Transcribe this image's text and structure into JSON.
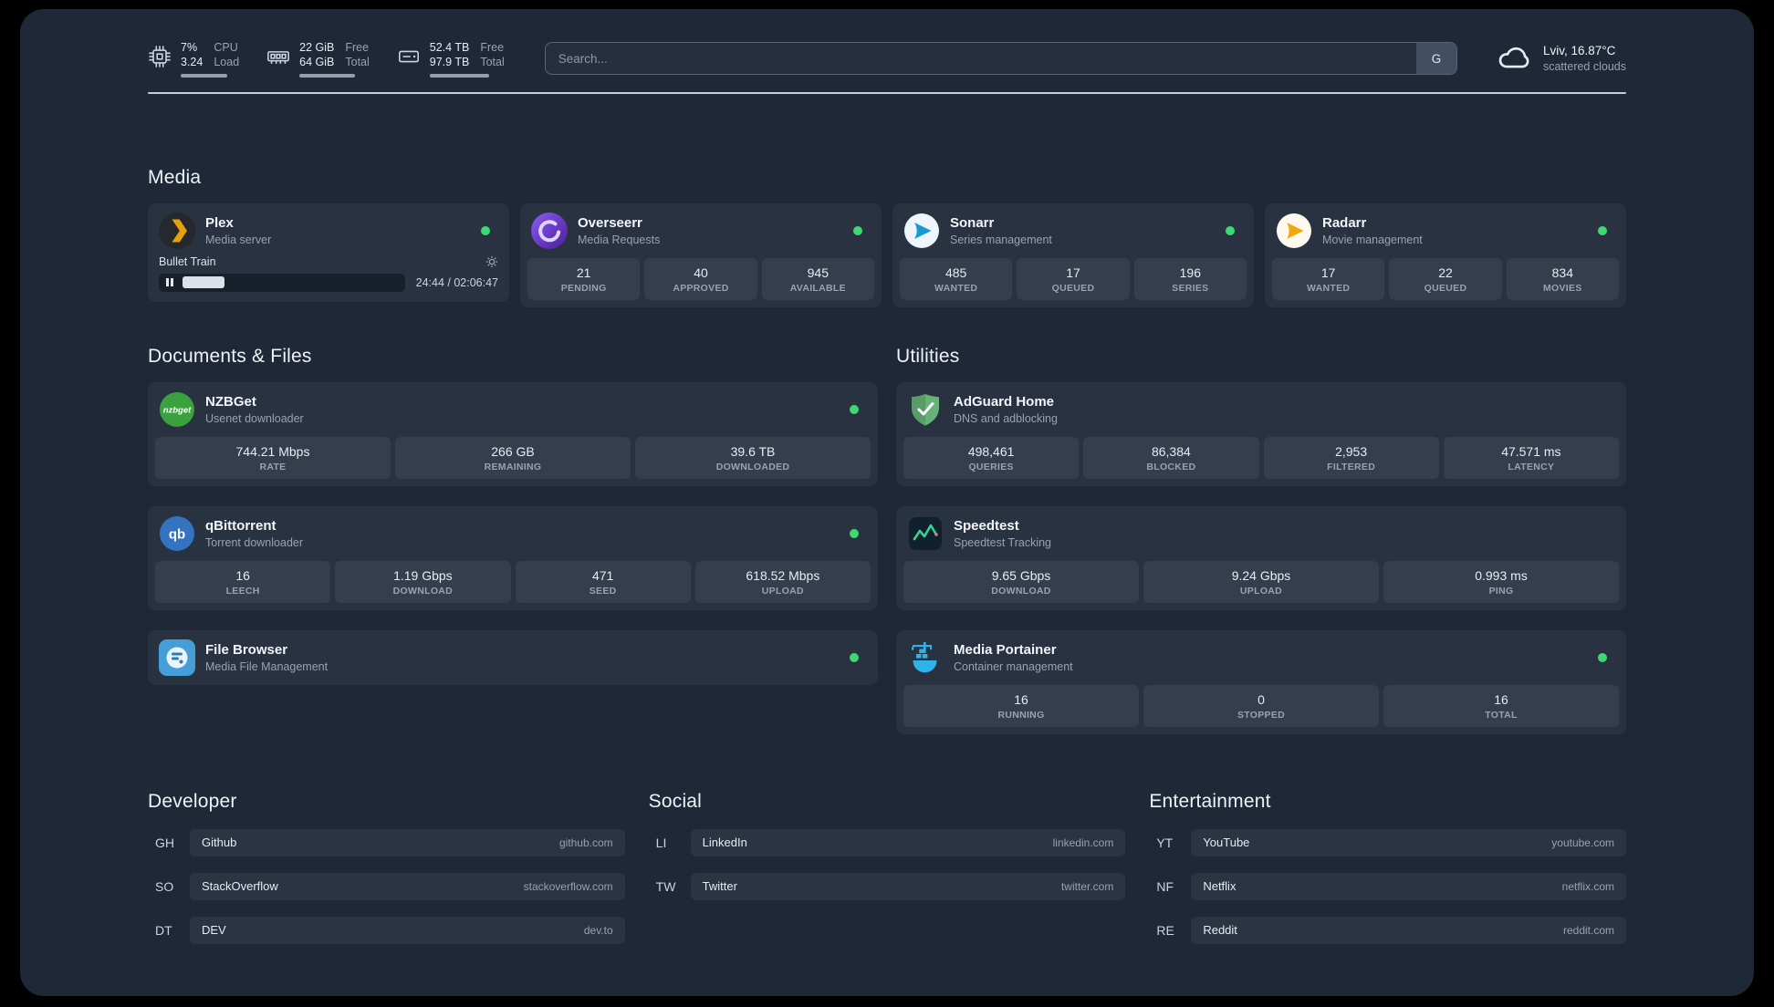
{
  "colors": {
    "background": "#1e2837",
    "status_online": "#3fd971",
    "plex_accent": "#e5a00d",
    "speedtest_line": "#34d399"
  },
  "topbar": {
    "cpu": {
      "percent": "7%",
      "load": "3.24",
      "label_top": "CPU",
      "label_bottom": "Load"
    },
    "memory": {
      "free": "22 GiB",
      "total": "64 GiB",
      "label_top": "Free",
      "label_bottom": "Total"
    },
    "disk": {
      "free": "52.4 TB",
      "total": "97.9 TB",
      "label_top": "Free",
      "label_bottom": "Total"
    },
    "search": {
      "placeholder": "Search...",
      "provider_button": "G"
    },
    "weather": {
      "location": "Lviv, 16.87°C",
      "condition": "scattered clouds"
    }
  },
  "sections": {
    "media": {
      "title": "Media",
      "services": [
        {
          "name": "Plex",
          "subtitle": "Media server",
          "icon": "plex-icon",
          "status": "online",
          "player": {
            "track": "Bullet Train",
            "time": "24:44 / 02:06:47"
          }
        },
        {
          "name": "Overseerr",
          "subtitle": "Media Requests",
          "icon": "overseerr-icon",
          "status": "online",
          "stats": [
            {
              "value": "21",
              "label": "PENDING"
            },
            {
              "value": "40",
              "label": "APPROVED"
            },
            {
              "value": "945",
              "label": "AVAILABLE"
            }
          ]
        },
        {
          "name": "Sonarr",
          "subtitle": "Series management",
          "icon": "sonarr-icon",
          "status": "online",
          "stats": [
            {
              "value": "485",
              "label": "WANTED"
            },
            {
              "value": "17",
              "label": "QUEUED"
            },
            {
              "value": "196",
              "label": "SERIES"
            }
          ]
        },
        {
          "name": "Radarr",
          "subtitle": "Movie management",
          "icon": "radarr-icon",
          "status": "online",
          "stats": [
            {
              "value": "17",
              "label": "WANTED"
            },
            {
              "value": "22",
              "label": "QUEUED"
            },
            {
              "value": "834",
              "label": "MOVIES"
            }
          ]
        }
      ]
    },
    "documents": {
      "title": "Documents & Files",
      "services": [
        {
          "name": "NZBGet",
          "subtitle": "Usenet downloader",
          "icon": "nzbget-icon",
          "icon_text": "nzbget",
          "status": "online",
          "stats": [
            {
              "value": "744.21 Mbps",
              "label": "RATE"
            },
            {
              "value": "266 GB",
              "label": "REMAINING"
            },
            {
              "value": "39.6 TB",
              "label": "DOWNLOADED"
            }
          ]
        },
        {
          "name": "qBittorrent",
          "subtitle": "Torrent downloader",
          "icon": "qbittorrent-icon",
          "icon_text": "qb",
          "status": "online",
          "stats": [
            {
              "value": "16",
              "label": "LEECH"
            },
            {
              "value": "1.19 Gbps",
              "label": "DOWNLOAD"
            },
            {
              "value": "471",
              "label": "SEED"
            },
            {
              "value": "618.52 Mbps",
              "label": "UPLOAD"
            }
          ]
        },
        {
          "name": "File Browser",
          "subtitle": "Media File Management",
          "icon": "filebrowser-icon",
          "status": "online",
          "stats": []
        }
      ]
    },
    "utilities": {
      "title": "Utilities",
      "services": [
        {
          "name": "AdGuard Home",
          "subtitle": "DNS and adblocking",
          "icon": "adguard-icon",
          "stats": [
            {
              "value": "498,461",
              "label": "QUERIES"
            },
            {
              "value": "86,384",
              "label": "BLOCKED"
            },
            {
              "value": "2,953",
              "label": "FILTERED"
            },
            {
              "value": "47.571 ms",
              "label": "LATENCY"
            }
          ]
        },
        {
          "name": "Speedtest",
          "subtitle": "Speedtest Tracking",
          "icon": "speedtest-icon",
          "stats": [
            {
              "value": "9.65 Gbps",
              "label": "DOWNLOAD"
            },
            {
              "value": "9.24 Gbps",
              "label": "UPLOAD"
            },
            {
              "value": "0.993 ms",
              "label": "PING"
            }
          ]
        },
        {
          "name": "Media Portainer",
          "subtitle": "Container management",
          "icon": "portainer-icon",
          "status": "online",
          "stats": [
            {
              "value": "16",
              "label": "RUNNING"
            },
            {
              "value": "0",
              "label": "STOPPED"
            },
            {
              "value": "16",
              "label": "TOTAL"
            }
          ]
        }
      ]
    },
    "bookmarks": [
      {
        "title": "Developer",
        "items": [
          {
            "abbr": "GH",
            "name": "Github",
            "domain": "github.com"
          },
          {
            "abbr": "SO",
            "name": "StackOverflow",
            "domain": "stackoverflow.com"
          },
          {
            "abbr": "DT",
            "name": "DEV",
            "domain": "dev.to"
          }
        ]
      },
      {
        "title": "Social",
        "items": [
          {
            "abbr": "LI",
            "name": "LinkedIn",
            "domain": "linkedin.com"
          },
          {
            "abbr": "TW",
            "name": "Twitter",
            "domain": "twitter.com"
          }
        ]
      },
      {
        "title": "Entertainment",
        "items": [
          {
            "abbr": "YT",
            "name": "YouTube",
            "domain": "youtube.com"
          },
          {
            "abbr": "NF",
            "name": "Netflix",
            "domain": "netflix.com"
          },
          {
            "abbr": "RE",
            "name": "Reddit",
            "domain": "reddit.com"
          }
        ]
      }
    ]
  }
}
